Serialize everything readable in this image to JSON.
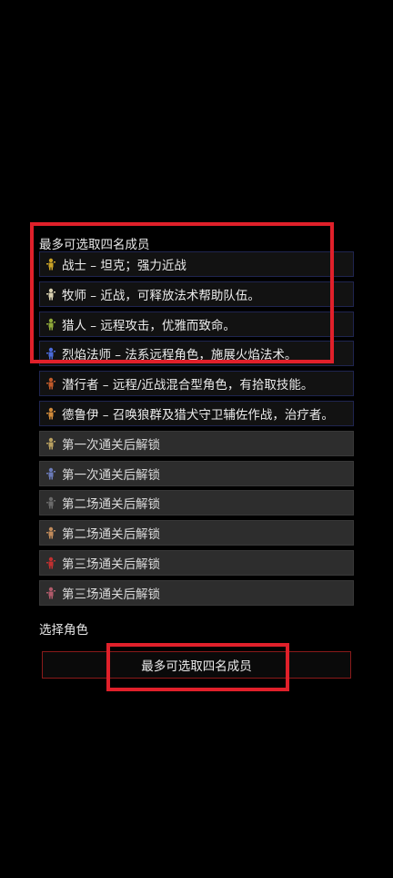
{
  "party": {
    "header": "最多可选取四名成员"
  },
  "roles": [
    {
      "label": "战士 – 坦克；强力近战",
      "locked": false,
      "icon": "warrior-icon",
      "color": "#c9a227"
    },
    {
      "label": "牧师 – 近战，可释放法术帮助队伍。",
      "locked": false,
      "icon": "priest-icon",
      "color": "#d8d0b0"
    },
    {
      "label": "猎人 – 远程攻击，优雅而致命。",
      "locked": false,
      "icon": "hunter-icon",
      "color": "#8fa83a"
    },
    {
      "label": "烈焰法师 – 法系远程角色，施展火焰法术。",
      "locked": false,
      "icon": "mage-icon",
      "color": "#4a6ad8"
    },
    {
      "label": "潜行者 – 远程/近战混合型角色，有拾取技能。",
      "locked": false,
      "icon": "rogue-icon",
      "color": "#c05a2a"
    },
    {
      "label": "德鲁伊 – 召唤狼群及猎犬守卫辅佐作战，治疗者。",
      "locked": false,
      "icon": "druid-icon",
      "color": "#d08a3a"
    },
    {
      "label": "第一次通关后解锁",
      "locked": true,
      "icon": "locked-class-icon",
      "color": "#b8a060"
    },
    {
      "label": "第一次通关后解锁",
      "locked": true,
      "icon": "locked-class-icon",
      "color": "#6a7ab8"
    },
    {
      "label": "第二场通关后解锁",
      "locked": true,
      "icon": "locked-class-icon",
      "color": "#6a6a6a"
    },
    {
      "label": "第二场通关后解锁",
      "locked": true,
      "icon": "locked-class-icon",
      "color": "#c08a5a"
    },
    {
      "label": "第三场通关后解锁",
      "locked": true,
      "icon": "locked-class-icon",
      "color": "#c03030"
    },
    {
      "label": "第三场通关后解锁",
      "locked": true,
      "icon": "locked-class-icon",
      "color": "#b05a6a"
    }
  ],
  "select_label": "选择角色",
  "confirm_button": {
    "label": "最多可选取四名成员"
  },
  "colors": {
    "highlight": "#e0202a",
    "unlocked_border": "#1f2550",
    "locked_bg": "#2d2d2d",
    "confirm_border": "#8a1a1a"
  }
}
